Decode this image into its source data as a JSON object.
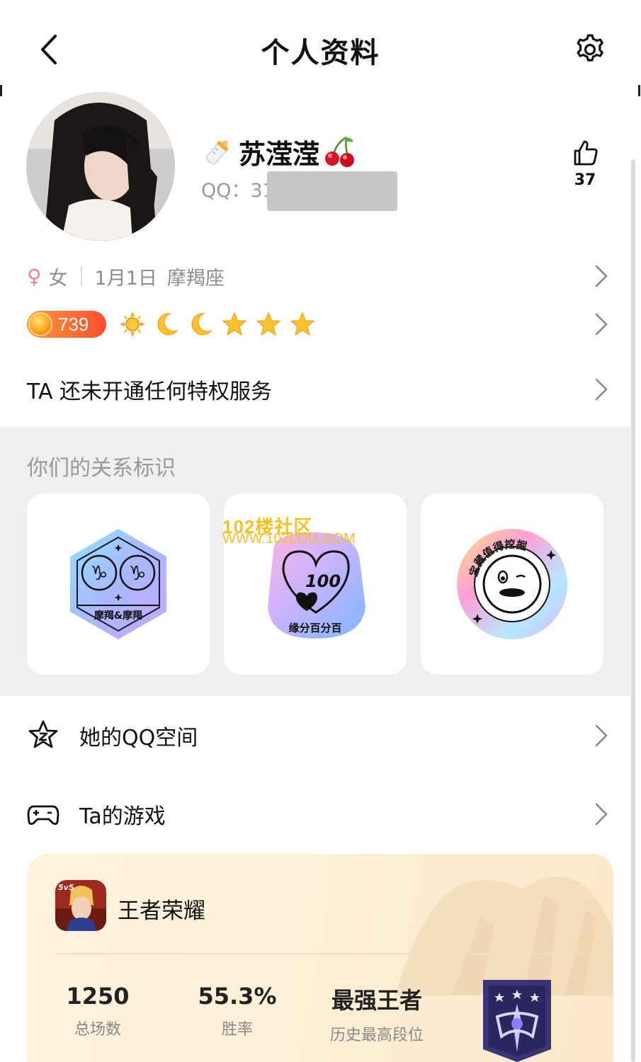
{
  "header": {
    "title": "个人资料",
    "back_icon": "chevron-left-icon",
    "settings_icon": "gear-icon"
  },
  "profile": {
    "nickname": "苏滢滢",
    "qq_label": "QQ：31",
    "likes": "37",
    "gender": "女",
    "birthday": "1月1日",
    "zodiac": "摩羯座",
    "level": "739",
    "privilege_text": "TA 还未开通任何特权服务"
  },
  "relation": {
    "title": "你们的关系标识",
    "badges": [
      {
        "label": "摩羯&摩羯"
      },
      {
        "label": "缘分百分百",
        "number": "100"
      },
      {
        "label": "宝藏值得挖掘"
      }
    ]
  },
  "watermark": {
    "line1": "102楼社区",
    "line2": "WWW.102LOU.COM"
  },
  "menu": {
    "qzone_label": "她的QQ空间",
    "games_label": "Ta的游戏"
  },
  "game": {
    "name": "王者荣耀",
    "icon_badge": "5v5",
    "stats": [
      {
        "value": "1250",
        "caption": "总场数"
      },
      {
        "value": "55.3%",
        "caption": "胜率"
      },
      {
        "value": "最强王者",
        "caption": "历史最高段位"
      }
    ]
  },
  "colors": {
    "accent_orange": "#ff6a2e",
    "gender_pink": "#f47aa5",
    "section_bg": "#efeff1",
    "game_card_bg": "#fdf0d8"
  }
}
